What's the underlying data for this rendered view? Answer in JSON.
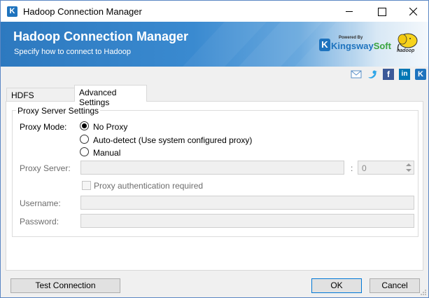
{
  "window": {
    "title": "Hadoop Connection Manager",
    "icon": "kingswaysoft-k-icon"
  },
  "banner": {
    "title": "Hadoop Connection Manager",
    "subtitle": "Specify how to connect to Hadoop",
    "logo_powered_by": "Powered By",
    "logo_kingsway": "Kingsway",
    "logo_soft": "Soft",
    "hadoop_logo_text": "hadoop"
  },
  "social": [
    "mail-icon",
    "twitter-icon",
    "facebook-icon",
    "linkedin-icon",
    "kingswaysoft-icon"
  ],
  "social_glyphs": {
    "facebook": "f",
    "linkedin": "in",
    "kingswaysoft": "K"
  },
  "tabs": [
    {
      "label": "HDFS Connection",
      "selected": false
    },
    {
      "label": "Advanced Settings",
      "selected": true
    }
  ],
  "proxy": {
    "group_title": "Proxy Server Settings",
    "mode_label": "Proxy Mode:",
    "options": [
      {
        "label": "No Proxy",
        "checked": true
      },
      {
        "label": "Auto-detect (Use system configured proxy)",
        "checked": false
      },
      {
        "label": "Manual",
        "checked": false
      }
    ],
    "server_label": "Proxy Server:",
    "server_value": "",
    "port_separator": ":",
    "port_value": "0",
    "auth_label": "Proxy authentication required",
    "auth_checked": false,
    "username_label": "Username:",
    "username_value": "",
    "password_label": "Password:",
    "password_value": ""
  },
  "buttons": {
    "test": "Test Connection",
    "ok": "OK",
    "cancel": "Cancel"
  },
  "colors": {
    "banner_blue": "#2d79bf",
    "brand_blue": "#1e73be",
    "brand_green": "#3aa53f",
    "accent_border": "#0078d7"
  }
}
